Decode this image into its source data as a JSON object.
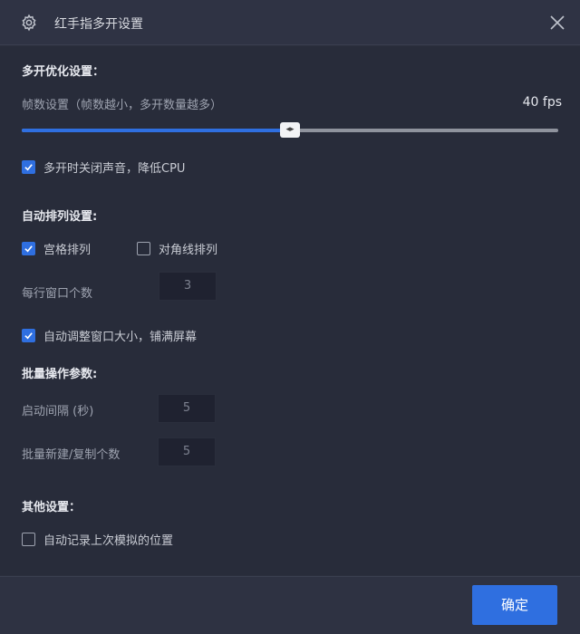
{
  "window": {
    "title": "红手指多开设置",
    "icon": "gear-icon",
    "close_icon": "close-icon"
  },
  "colors": {
    "accent": "#2f6fe0",
    "background": "#282c3a",
    "titlebar": "#2f3344"
  },
  "section_optimize": {
    "title": "多开优化设置：",
    "fps_label": "帧数设置（帧数越小，多开数量越多）",
    "fps_value": "40 fps",
    "slider_fraction": 0.5,
    "mute_checkbox": {
      "label": "多开时关闭声音，降低CPU",
      "checked": true
    }
  },
  "section_arrange": {
    "title": "自动排列设置:",
    "grid_option": {
      "label": "宫格排列",
      "checked": true
    },
    "diagonal_option": {
      "label": "对角线排列",
      "checked": false
    },
    "per_row_label": "每行窗口个数",
    "per_row_value": "3",
    "autofit_checkbox": {
      "label": "自动调整窗口大小，铺满屏幕",
      "checked": true
    }
  },
  "section_batch": {
    "title": "批量操作参数:",
    "interval_label": "启动间隔 (秒)",
    "interval_value": "5",
    "count_label": "批量新建/复制个数",
    "count_value": "5"
  },
  "section_other": {
    "title": "其他设置：",
    "remember_checkbox": {
      "label": "自动记录上次模拟的位置",
      "checked": false
    }
  },
  "footer": {
    "ok_label": "确定"
  }
}
